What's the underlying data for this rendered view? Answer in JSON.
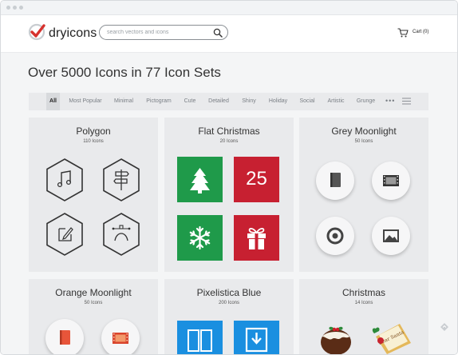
{
  "brand": {
    "name": "dryicons"
  },
  "search": {
    "placeholder": "search vectors and icons"
  },
  "cart": {
    "label": "Cart (0)"
  },
  "headline": "Over 5000 Icons in 77 Icon Sets",
  "filters": [
    "All",
    "Most Popular",
    "Minimal",
    "Pictogram",
    "Cute",
    "Detailed",
    "Shiny",
    "Holiday",
    "Social",
    "Artistic",
    "Grunge"
  ],
  "filter_more": "•••",
  "sets": [
    {
      "title": "Polygon",
      "count": "110 Icons",
      "icons": [
        "music-note-icon",
        "signpost-icon",
        "edit-icon",
        "vector-pen-icon"
      ]
    },
    {
      "title": "Flat Christmas",
      "count": "20 Icons",
      "icons": [
        "christmas-tree-icon",
        "calendar-25-icon",
        "snowflake-icon",
        "gift-icon"
      ],
      "calendar_number": "25",
      "colors": [
        "#1f9a4a",
        "#c72031"
      ]
    },
    {
      "title": "Grey Moonlight",
      "count": "50 Icons",
      "icons": [
        "book-icon",
        "film-icon",
        "record-icon",
        "image-icon"
      ]
    },
    {
      "title": "Orange Moonlight",
      "count": "50 Icons",
      "icons": [
        "book-icon",
        "film-icon"
      ]
    },
    {
      "title": "Pixelistica Blue",
      "count": "200 Icons",
      "icons": [
        "open-book-icon",
        "download-icon"
      ],
      "colors": [
        "#1a8fe0"
      ]
    },
    {
      "title": "Christmas",
      "count": "14 Icons",
      "icons": [
        "pudding-icon",
        "santa-letter-icon"
      ],
      "letter_text": "Dear Santa"
    }
  ],
  "colors": {
    "accent": "#d6322e",
    "background": "#f4f5f6",
    "card": "#e9eaec"
  }
}
